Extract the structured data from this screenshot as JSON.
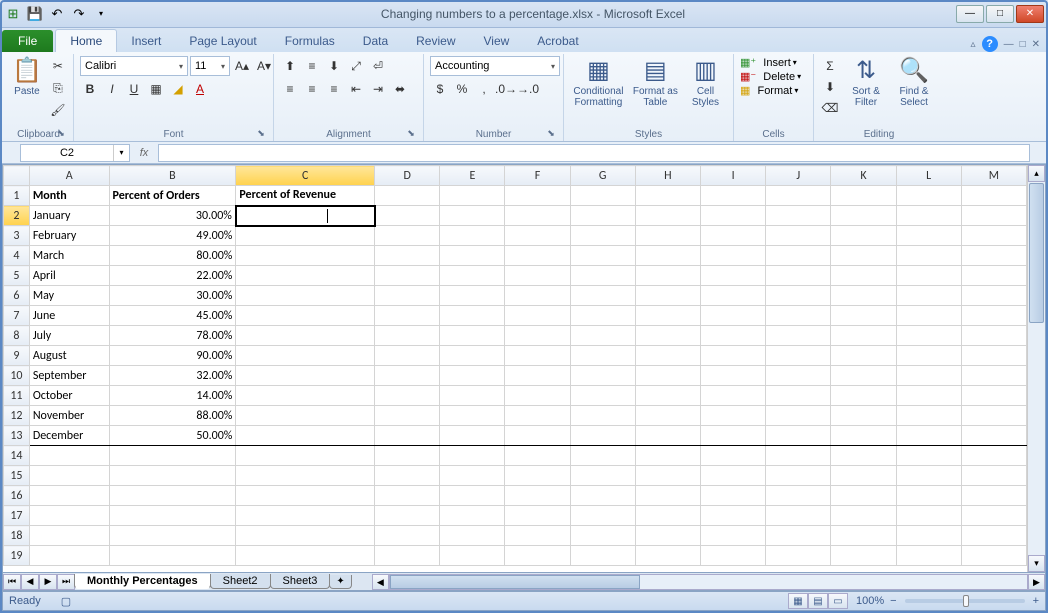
{
  "title": "Changing numbers to a percentage.xlsx - Microsoft Excel",
  "tabs": {
    "file": "File",
    "home": "Home",
    "insert": "Insert",
    "pageLayout": "Page Layout",
    "formulas": "Formulas",
    "data": "Data",
    "review": "Review",
    "view": "View",
    "acrobat": "Acrobat"
  },
  "ribbon": {
    "clipboard": {
      "paste": "Paste",
      "label": "Clipboard"
    },
    "font": {
      "name": "Calibri",
      "size": "11",
      "label": "Font"
    },
    "alignment": {
      "label": "Alignment"
    },
    "number": {
      "format": "Accounting",
      "label": "Number"
    },
    "styles": {
      "cond": "Conditional Formatting",
      "fmtTable": "Format as Table",
      "cellStyles": "Cell Styles",
      "label": "Styles"
    },
    "cells": {
      "insert": "Insert",
      "delete": "Delete",
      "format": "Format",
      "label": "Cells"
    },
    "editing": {
      "sort": "Sort & Filter",
      "find": "Find & Select",
      "label": "Editing"
    }
  },
  "namebox": "C2",
  "fx": "",
  "columns": [
    "A",
    "B",
    "C",
    "D",
    "E",
    "F",
    "G",
    "H",
    "I",
    "J",
    "K",
    "L",
    "M"
  ],
  "headers": {
    "A": "Month",
    "B": "Percent of Orders",
    "C": "Percent of Revenue"
  },
  "rows": [
    {
      "n": 2,
      "A": "January",
      "B": "30.00%"
    },
    {
      "n": 3,
      "A": "February",
      "B": "49.00%"
    },
    {
      "n": 4,
      "A": "March",
      "B": "80.00%"
    },
    {
      "n": 5,
      "A": "April",
      "B": "22.00%"
    },
    {
      "n": 6,
      "A": "May",
      "B": "30.00%"
    },
    {
      "n": 7,
      "A": "June",
      "B": "45.00%"
    },
    {
      "n": 8,
      "A": "July",
      "B": "78.00%"
    },
    {
      "n": 9,
      "A": "August",
      "B": "90.00%"
    },
    {
      "n": 10,
      "A": "September",
      "B": "32.00%"
    },
    {
      "n": 11,
      "A": "October",
      "B": "14.00%"
    },
    {
      "n": 12,
      "A": "November",
      "B": "88.00%"
    },
    {
      "n": 13,
      "A": "December",
      "B": "50.00%"
    }
  ],
  "emptyRows": [
    14,
    15,
    16,
    17,
    18,
    19
  ],
  "sheets": {
    "active": "Monthly Percentages",
    "s2": "Sheet2",
    "s3": "Sheet3"
  },
  "status": "Ready",
  "zoom": "100%"
}
